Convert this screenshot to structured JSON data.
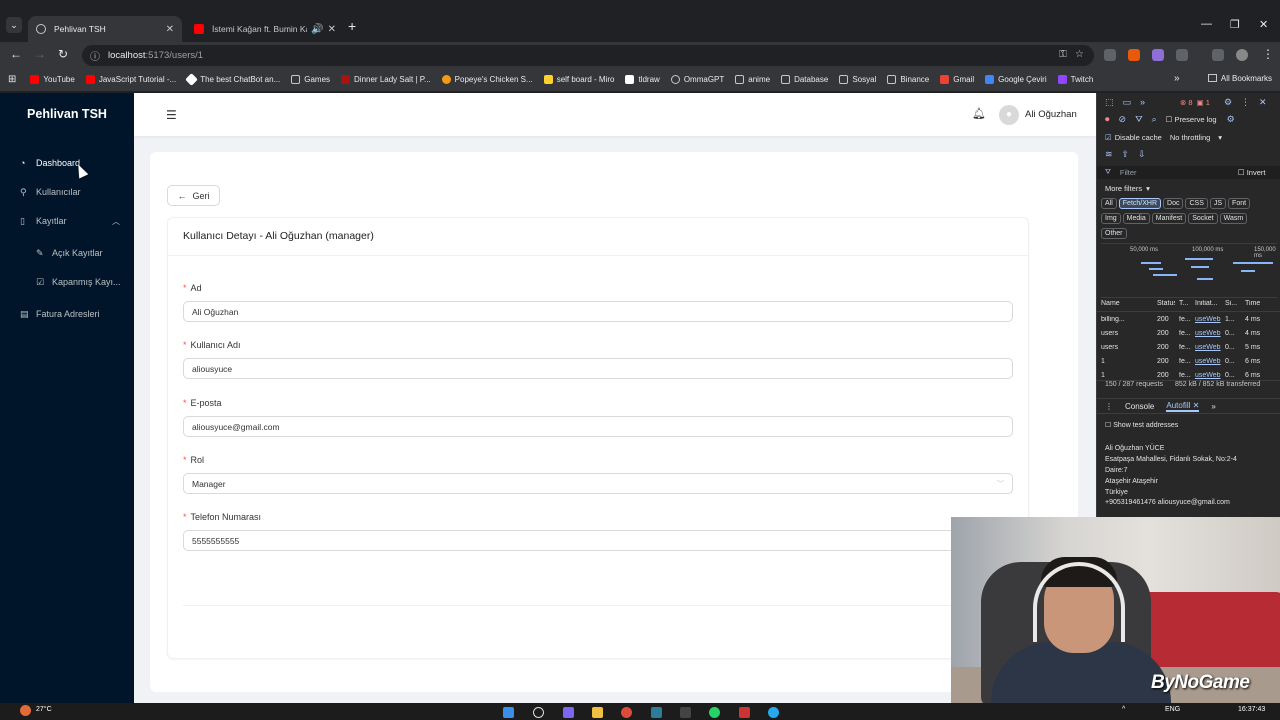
{
  "browser": {
    "tabs": [
      {
        "title": "Pehlivan TSH",
        "active": true
      },
      {
        "title": "İstemi Kağan ft. Bumin Kağ",
        "active": false
      }
    ],
    "url_host": "localhost",
    "url_path": ":5173/users/1",
    "bookmarks": [
      "YouTube",
      "JavaScript Tutorial -...",
      "The best ChatBot an...",
      "Games",
      "Dinner Lady Salt | P...",
      "Popeye's Chicken S...",
      "self board - Miro",
      "tldraw",
      "OmmaGPT",
      "anime",
      "Database",
      "Sosyal",
      "Binance",
      "Gmail",
      "Google Çeviri",
      "Twitch"
    ],
    "all_bookmarks": "All Bookmarks"
  },
  "app": {
    "brand": "Pehlivan TSH",
    "menu": {
      "dashboard": "Dashboard",
      "users": "Kullanıcılar",
      "records": "Kayıtlar",
      "open_records": "Açık Kayıtlar",
      "closed_records": "Kapanmış Kayı...",
      "invoice_addresses": "Fatura Adresleri"
    },
    "header": {
      "username": "Ali Oğuzhan"
    },
    "back_label": "Geri",
    "detail_title": "Kullanıcı Detayı - Ali Oğuzhan (manager)",
    "fields": {
      "name_label": "Ad",
      "name_value": "Ali Oğuzhan",
      "username_label": "Kullanıcı Adı",
      "username_value": "aliousyuce",
      "email_label": "E-posta",
      "email_value": "aliousyuce@gmail.com",
      "role_label": "Rol",
      "role_value": "Manager",
      "phone_label": "Telefon Numarası",
      "phone_value": "5555555555"
    }
  },
  "devtools": {
    "errors": "8",
    "warnings": "1",
    "preserve_log": "Preserve log",
    "disable_cache": "Disable cache",
    "throttling": "No throttling",
    "filter": "Filter",
    "invert": "Invert",
    "more_filters": "More filters",
    "chips": [
      "All",
      "Fetch/XHR",
      "Doc",
      "CSS",
      "JS",
      "Font",
      "Img",
      "Media",
      "Manifest",
      "Socket",
      "Wasm",
      "Other"
    ],
    "timeline_labels": [
      "50,000 ms",
      "100,000 ms",
      "150,000 ms"
    ],
    "columns": [
      "Name",
      "Status",
      "T...",
      "Initiat...",
      "Si...",
      "Time"
    ],
    "rows": [
      {
        "name": "billing...",
        "status": "200",
        "type": "fe...",
        "initiator": "useWeb",
        "size": "1...",
        "time": "4 ms"
      },
      {
        "name": "users",
        "status": "200",
        "type": "fe...",
        "initiator": "useWeb",
        "size": "0...",
        "time": "4 ms"
      },
      {
        "name": "users",
        "status": "200",
        "type": "fe...",
        "initiator": "useWeb",
        "size": "0...",
        "time": "5 ms"
      },
      {
        "name": "1",
        "status": "200",
        "type": "fe...",
        "initiator": "useWeb",
        "size": "0...",
        "time": "6 ms"
      },
      {
        "name": "1",
        "status": "200",
        "type": "fe...",
        "initiator": "useWeb",
        "size": "0...",
        "time": "6 ms"
      }
    ],
    "requests": "150 / 287 requests",
    "transferred": "852 kB / 852 kB transferred",
    "drawer_console": "Console",
    "drawer_autofill": "Autofill",
    "show_test": "Show test addresses",
    "autofill_lines": [
      "Ali Oğuzhan YÜCE",
      "Esatpaşa Mahallesi, Fidanlı Sokak, No:2-4",
      "Daire:7",
      "Ataşehir Ataşehir",
      "Türkiye",
      "+905319461476 aliousyuce@gmail.com"
    ]
  },
  "overlay": {
    "logo": "ByNoGame"
  },
  "taskbar": {
    "temp": "27°C",
    "lang": "ENG",
    "time": "16:37:43"
  }
}
